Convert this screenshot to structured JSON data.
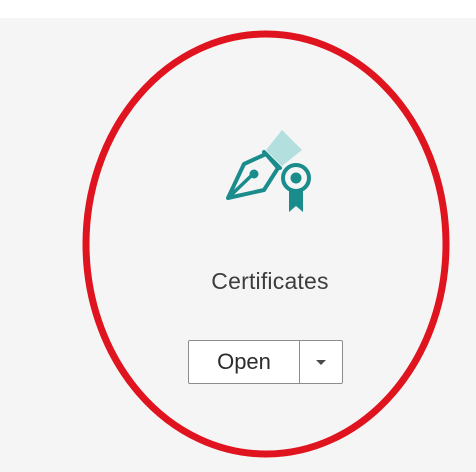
{
  "tool_card": {
    "icon": "certificate-pen-icon",
    "label": "Certificates",
    "open_button": {
      "label": "Open",
      "dropdown_icon": "chevron-down-icon"
    }
  },
  "annotation": {
    "shape": "ellipse",
    "color": "#e0141e"
  },
  "colors": {
    "icon_teal": "#1a8c8c",
    "icon_light_teal": "#b3e0de",
    "card_background": "#f5f5f5"
  }
}
